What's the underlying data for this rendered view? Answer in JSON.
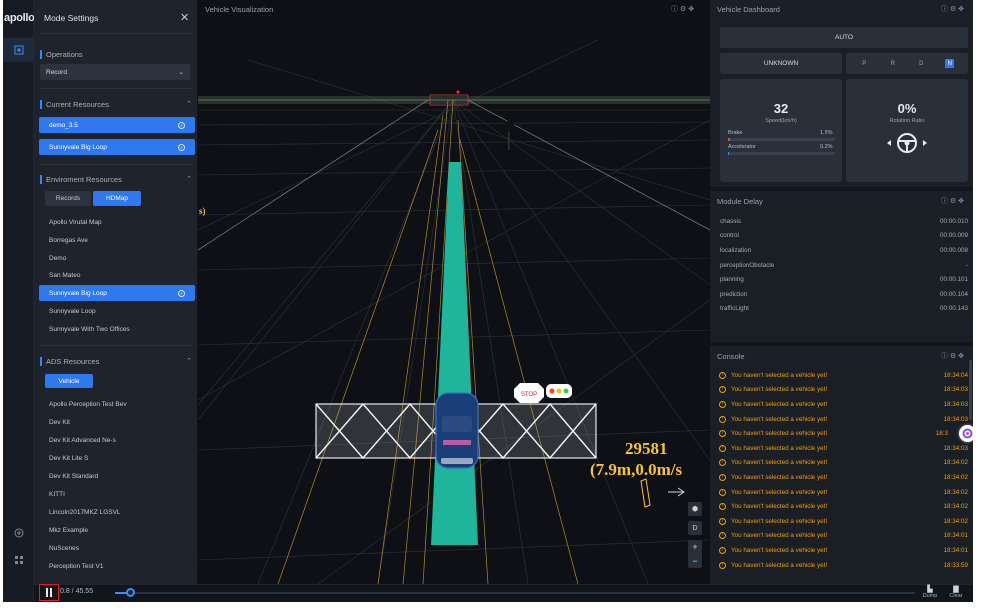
{
  "brand": {
    "logo": "apollo"
  },
  "panel": {
    "title": "Mode Settings",
    "operations": {
      "label": "Operations",
      "value": "Record"
    },
    "current_resources": {
      "label": "Current Resources",
      "items": [
        "demo_3.5",
        "Sunnyvale Big Loop"
      ]
    },
    "env_resources": {
      "label": "Enviroment Resources",
      "tabs": [
        "Records",
        "HDMap"
      ],
      "active_tab": "HDMap",
      "items": [
        "Apollo Virutal Map",
        "Borregas Ave",
        "Demo",
        "San Mateo",
        "Sunnyvale Big Loop",
        "Sunnyvale Loop",
        "Sunnyvale With Two Offices"
      ],
      "selected": "Sunnyvale Big Loop"
    },
    "ads_resources": {
      "label": "ADS Resources",
      "tab": "Vehicle",
      "items": [
        "Apollo Perception Test Bev",
        "Dev Kit",
        "Dev Kit Advanced Ne-s",
        "Dev Kit Lite S",
        "Dev Kit Standard",
        "KITTI",
        "Lincoln2017MKZ LGSVL",
        "Mkz Example",
        "NuScenes",
        "Perception Test V1"
      ]
    }
  },
  "viz": {
    "title": "Vehicle Visualization",
    "obstacle_id": "29581",
    "obstacle_info": "(7.9m,0.0m/s",
    "edge_text": "s)",
    "stop_sign": "STOP",
    "view_buttons": [
      "D",
      "+",
      "−"
    ]
  },
  "dashboard": {
    "title": "Vehicle Dashboard",
    "mode": "AUTO",
    "status": "UNKNOWN",
    "gears": [
      "P",
      "R",
      "D",
      "N"
    ],
    "active_gear": "N",
    "speed": "32",
    "speed_label": "Speed(km/h)",
    "brake_label": "Brake",
    "brake_value": "1.5%",
    "brake_pct": 1.5,
    "accel_label": "Accelerator",
    "accel_value": "0.2%",
    "accel_pct": 0.2,
    "rotation": "0%",
    "rotation_label": "Rotation Ratio"
  },
  "module_delay": {
    "title": "Module Delay",
    "rows": [
      {
        "name": "chassis",
        "value": "00:00.010"
      },
      {
        "name": "control",
        "value": "00:00.009"
      },
      {
        "name": "localization",
        "value": "00:00.008"
      },
      {
        "name": "perceptionObstacle",
        "value": "-"
      },
      {
        "name": "planning",
        "value": "00:00.101"
      },
      {
        "name": "prediction",
        "value": "00:00.104"
      },
      {
        "name": "trafficLight",
        "value": "00:00.143"
      }
    ]
  },
  "console": {
    "title": "Console",
    "rows": [
      {
        "msg": "You haven't selected a vehicle yet!",
        "ts": "18:34:04"
      },
      {
        "msg": "You haven't selected a vehicle yet!",
        "ts": "18:34:03"
      },
      {
        "msg": "You haven't selected a vehicle yet!",
        "ts": "18:34:03"
      },
      {
        "msg": "You haven't selected a vehicle yet!",
        "ts": "18:34:03"
      },
      {
        "msg": "You haven't selected a vehicle yet!",
        "ts": "18:3"
      },
      {
        "msg": "You haven't selected a vehicle yet!",
        "ts": "18:34:03"
      },
      {
        "msg": "You haven't selected a vehicle yet!",
        "ts": "18:34:02"
      },
      {
        "msg": "You haven't selected a vehicle yet!",
        "ts": "18:34:02"
      },
      {
        "msg": "You haven't selected a vehicle yet!",
        "ts": "18:34:02"
      },
      {
        "msg": "You haven't selected a vehicle yet!",
        "ts": "18:34:02"
      },
      {
        "msg": "You haven't selected a vehicle yet!",
        "ts": "18:34:02"
      },
      {
        "msg": "You haven't selected a vehicle yet!",
        "ts": "18:34:01"
      },
      {
        "msg": "You haven't selected a vehicle yet!",
        "ts": "18:34:01"
      },
      {
        "msg": "You haven't selected a vehicle yet!",
        "ts": "18:33:59"
      }
    ]
  },
  "playback": {
    "time": "0.8 / 45.55",
    "progress": 0.018,
    "dump": "Dump",
    "clear": "Clear"
  },
  "colors": {
    "accent": "#2e79f0",
    "lane": "#1fb59a",
    "warning": "#f1a000",
    "label": "#f5c531"
  }
}
